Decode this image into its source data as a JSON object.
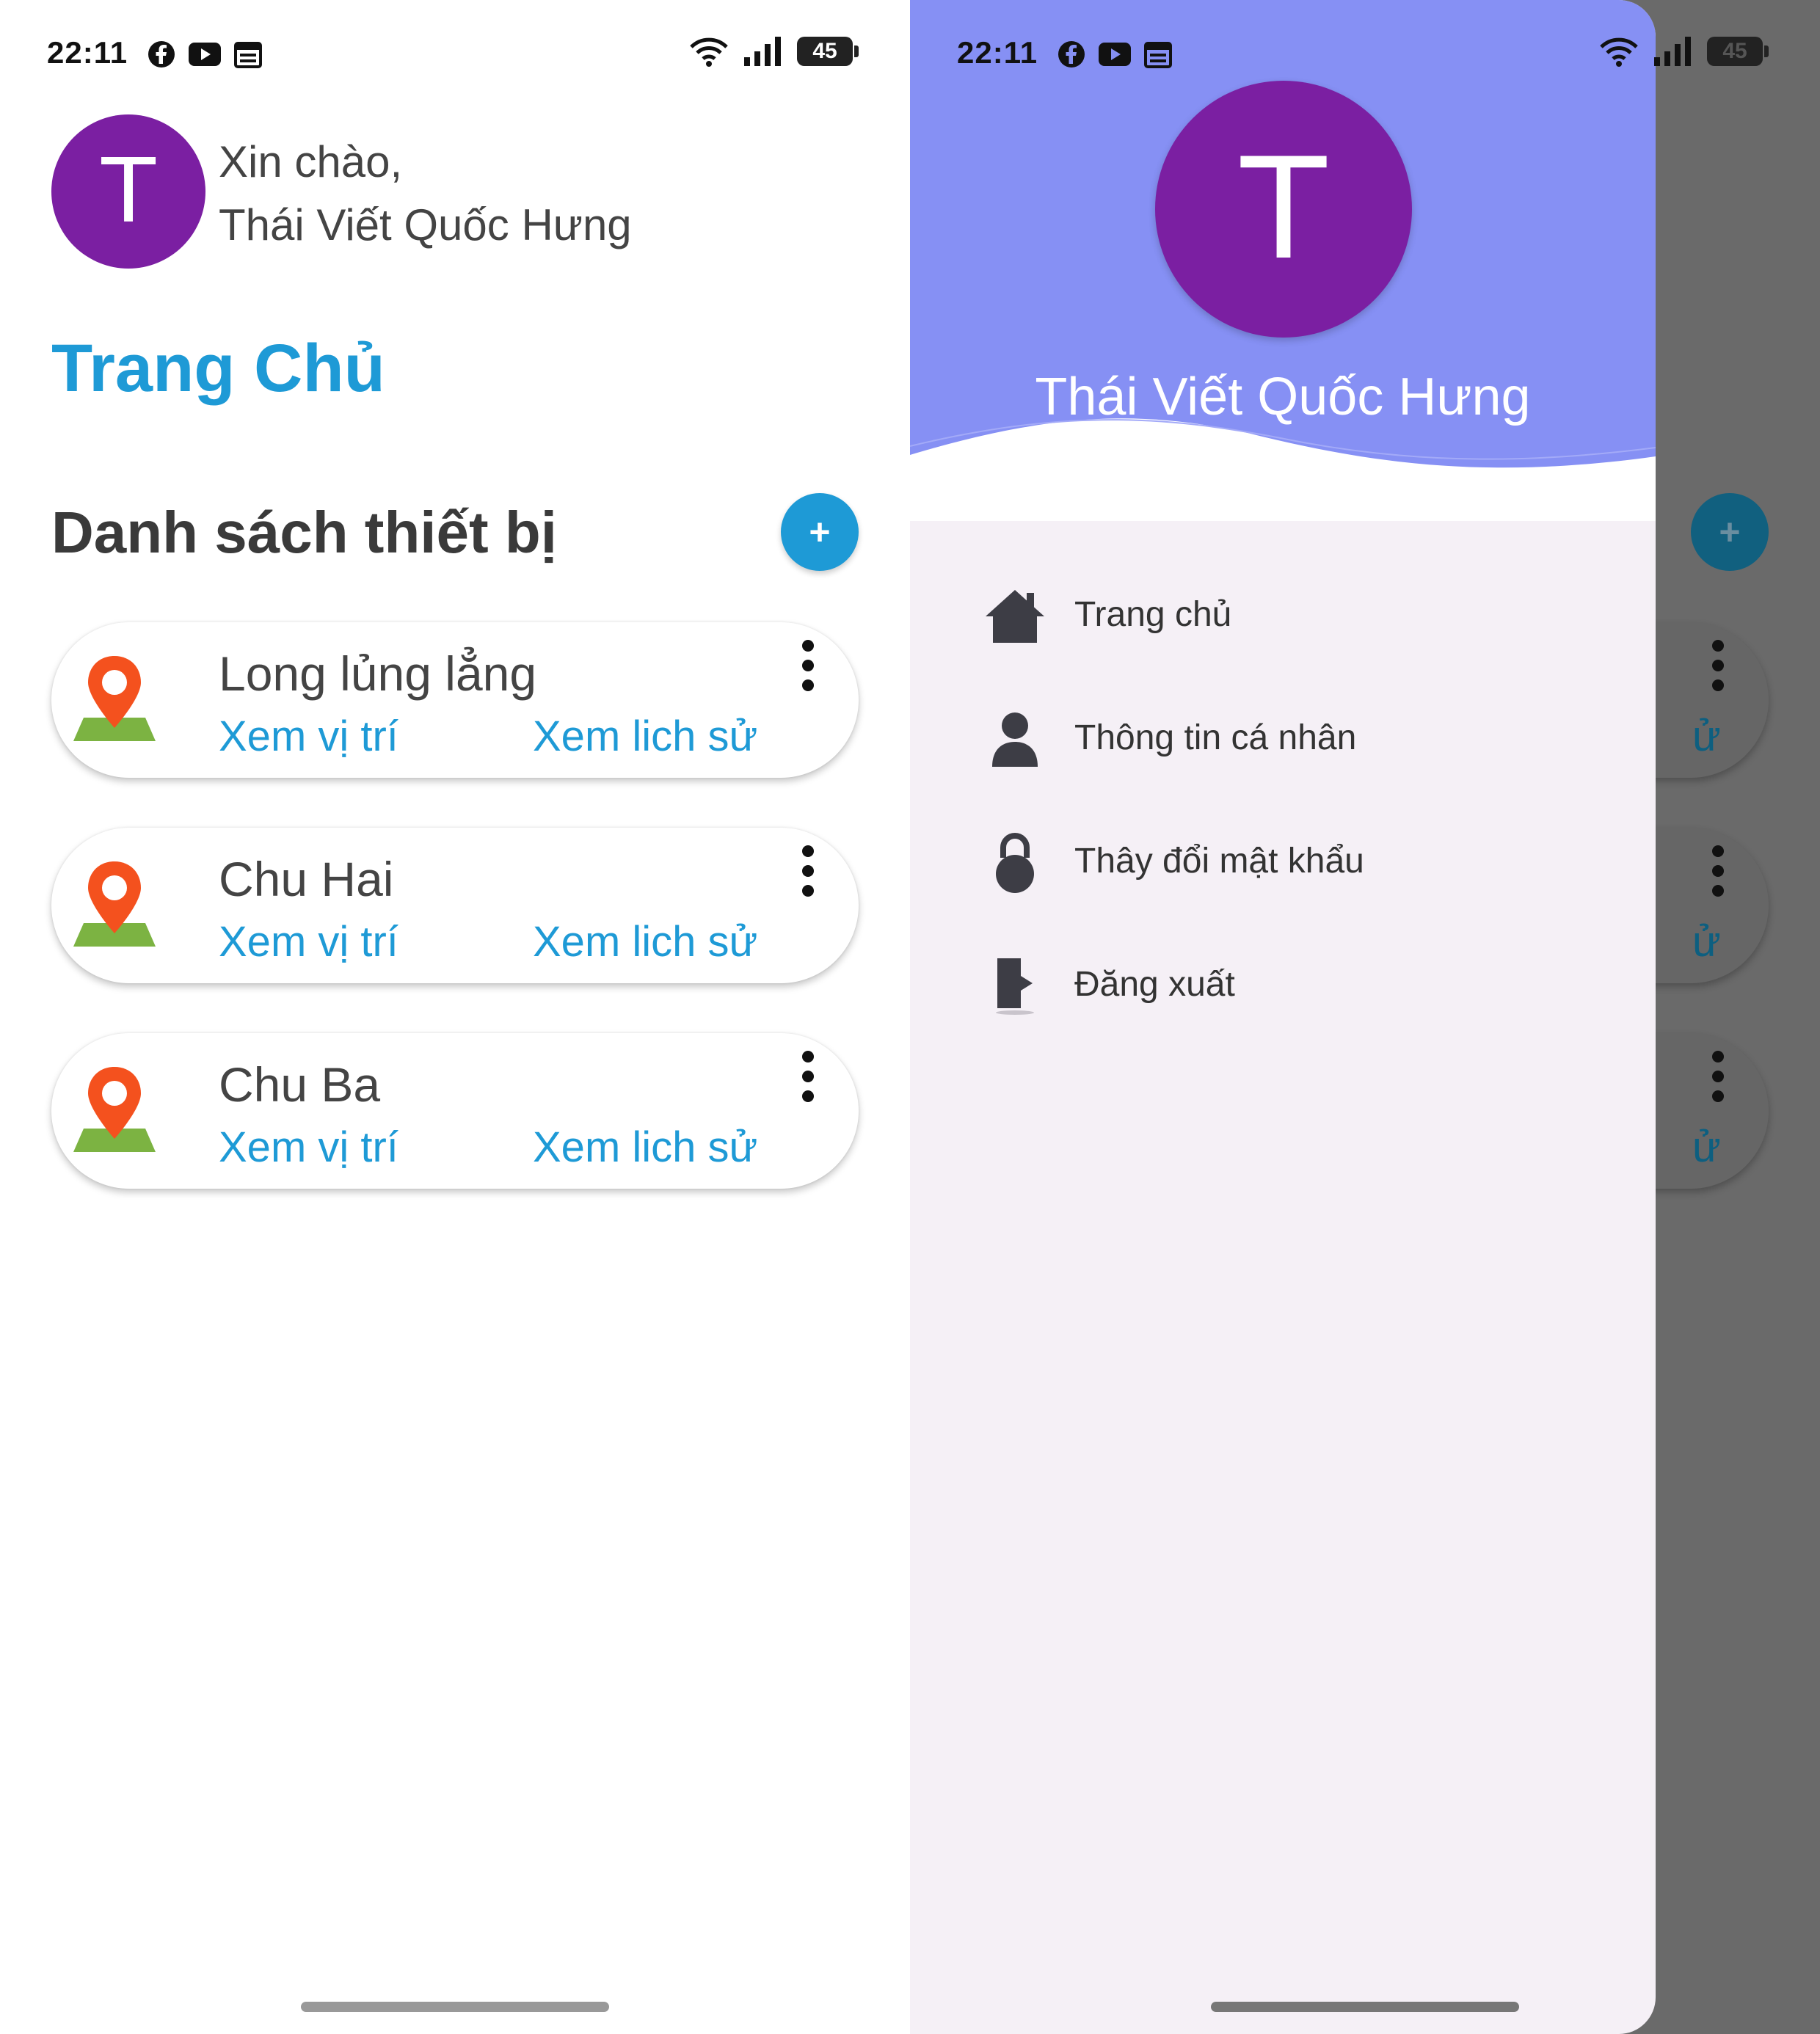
{
  "status_bar": {
    "time": "22:11",
    "battery": "45",
    "left_icons": [
      "facebook-icon",
      "youtube-icon",
      "calendar-icon"
    ],
    "right_icons": [
      "wifi-icon",
      "signal-icon",
      "battery-icon"
    ]
  },
  "home": {
    "avatar_letter": "T",
    "greeting_line1": "Xin chào,",
    "greeting_line2": "Thái Viết Quốc Hưng",
    "page_title": "Trang Chủ",
    "section_title": "Danh sách thiết bị",
    "add_button": "+",
    "devices": [
      {
        "name": "Long lủng lẳng",
        "location_link": "Xem vị trí",
        "history_link": "Xem lich sử"
      },
      {
        "name": "Chu Hai",
        "location_link": "Xem vị trí",
        "history_link": "Xem lich sử"
      },
      {
        "name": "Chu Ba",
        "location_link": "Xem vị trí",
        "history_link": "Xem lich sử"
      }
    ]
  },
  "drawer": {
    "avatar_letter": "T",
    "user_name": "Thái Viết Quốc Hưng",
    "menu": [
      {
        "label": "Trang chủ",
        "icon": "home-icon"
      },
      {
        "label": "Thông tin cá nhân",
        "icon": "person-icon"
      },
      {
        "label": "Thây đổi mật khẩu",
        "icon": "lock-icon"
      },
      {
        "label": "Đăng xuất",
        "icon": "logout-icon"
      }
    ],
    "behind_history_fragment": "ử"
  },
  "colors": {
    "accent": "#1e9ad6",
    "avatar": "#7b1fa2",
    "drawer_header": "#8690f4",
    "drawer_bg": "#f5f0f6",
    "pin": "#f4511e",
    "map_green": "#7cb342"
  }
}
